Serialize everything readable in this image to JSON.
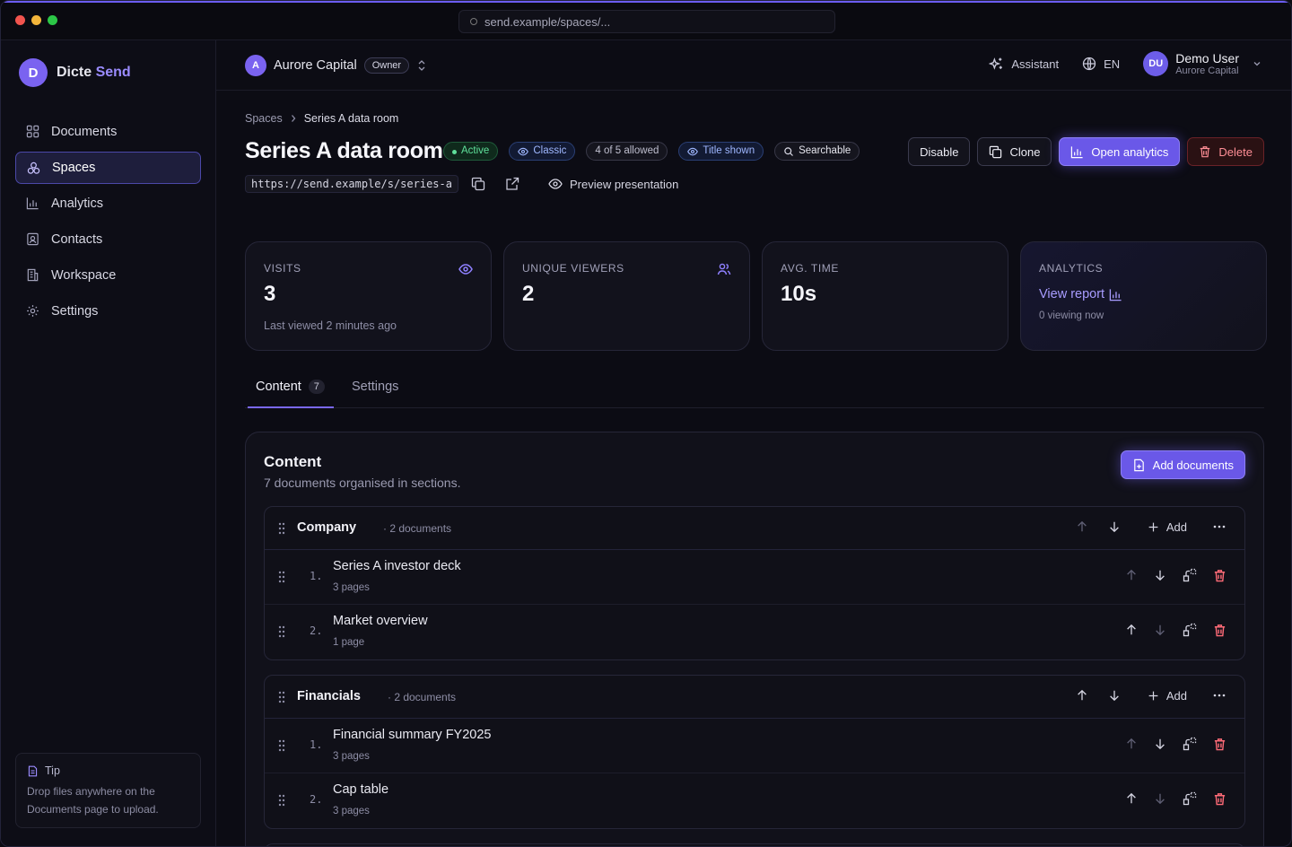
{
  "browser": {
    "url": "send.example/spaces/..."
  },
  "colors": {
    "accent": "#6a58e8",
    "success": "#5fe09a",
    "danger": "#ff6b77"
  },
  "sidebar": {
    "brand_initial": "D",
    "brand_name": "Dicte",
    "brand_accent": "Send",
    "items": [
      {
        "label": "Documents",
        "icon": "grid-icon"
      },
      {
        "label": "Spaces",
        "icon": "spaces-icon",
        "active": true
      },
      {
        "label": "Analytics",
        "icon": "bar-chart-icon"
      },
      {
        "label": "Contacts",
        "icon": "contact-card-icon"
      },
      {
        "label": "Workspace",
        "icon": "building-icon"
      },
      {
        "label": "Settings",
        "icon": "gear-icon"
      }
    ],
    "tip": {
      "title": "Tip",
      "text": "Drop files anywhere on the Documents page to upload."
    }
  },
  "topbar": {
    "org_initial": "A",
    "org_name": "Aurore Capital",
    "org_role": "Owner",
    "assistant": "Assistant",
    "language": "EN",
    "user_initials": "DU",
    "user_name": "Demo User",
    "user_org": "Aurore Capital"
  },
  "page": {
    "breadcrumb": [
      "Spaces",
      "Series A data room"
    ],
    "title": "Series A data room",
    "badges": {
      "active": "Active",
      "classic": "Classic",
      "allowed": "4 of 5 allowed",
      "title_shown": "Title shown",
      "searchable": "Searchable"
    },
    "actions": {
      "disable": "Disable",
      "clone": "Clone",
      "open_analytics": "Open analytics",
      "delete": "Delete"
    },
    "share_url": "https://send.example/s/series-a",
    "preview": "Preview presentation"
  },
  "stats": {
    "visits": {
      "label": "VISITS",
      "value": "3",
      "sub": "Last viewed 2 minutes ago"
    },
    "unique": {
      "label": "UNIQUE VIEWERS",
      "value": "2"
    },
    "avg": {
      "label": "AVG. TIME",
      "value": "10s"
    },
    "analytics": {
      "label": "ANALYTICS",
      "link": "View report",
      "sub": "0 viewing now"
    }
  },
  "tabs": {
    "content": "Content",
    "content_count": "7",
    "settings": "Settings"
  },
  "content": {
    "title": "Content",
    "subtitle": "7 documents organised in sections.",
    "add_documents": "Add documents",
    "add_label": "Add",
    "sections": [
      {
        "name": "Company",
        "count": "· 2 documents",
        "docs": [
          {
            "num": "1.",
            "name": "Series A investor deck",
            "meta": "3 pages"
          },
          {
            "num": "2.",
            "name": "Market overview",
            "meta": "1 page"
          }
        ]
      },
      {
        "name": "Financials",
        "count": "· 2 documents",
        "docs": [
          {
            "num": "1.",
            "name": "Financial summary FY2025",
            "meta": "3 pages"
          },
          {
            "num": "2.",
            "name": "Cap table",
            "meta": "3 pages"
          }
        ]
      }
    ]
  }
}
